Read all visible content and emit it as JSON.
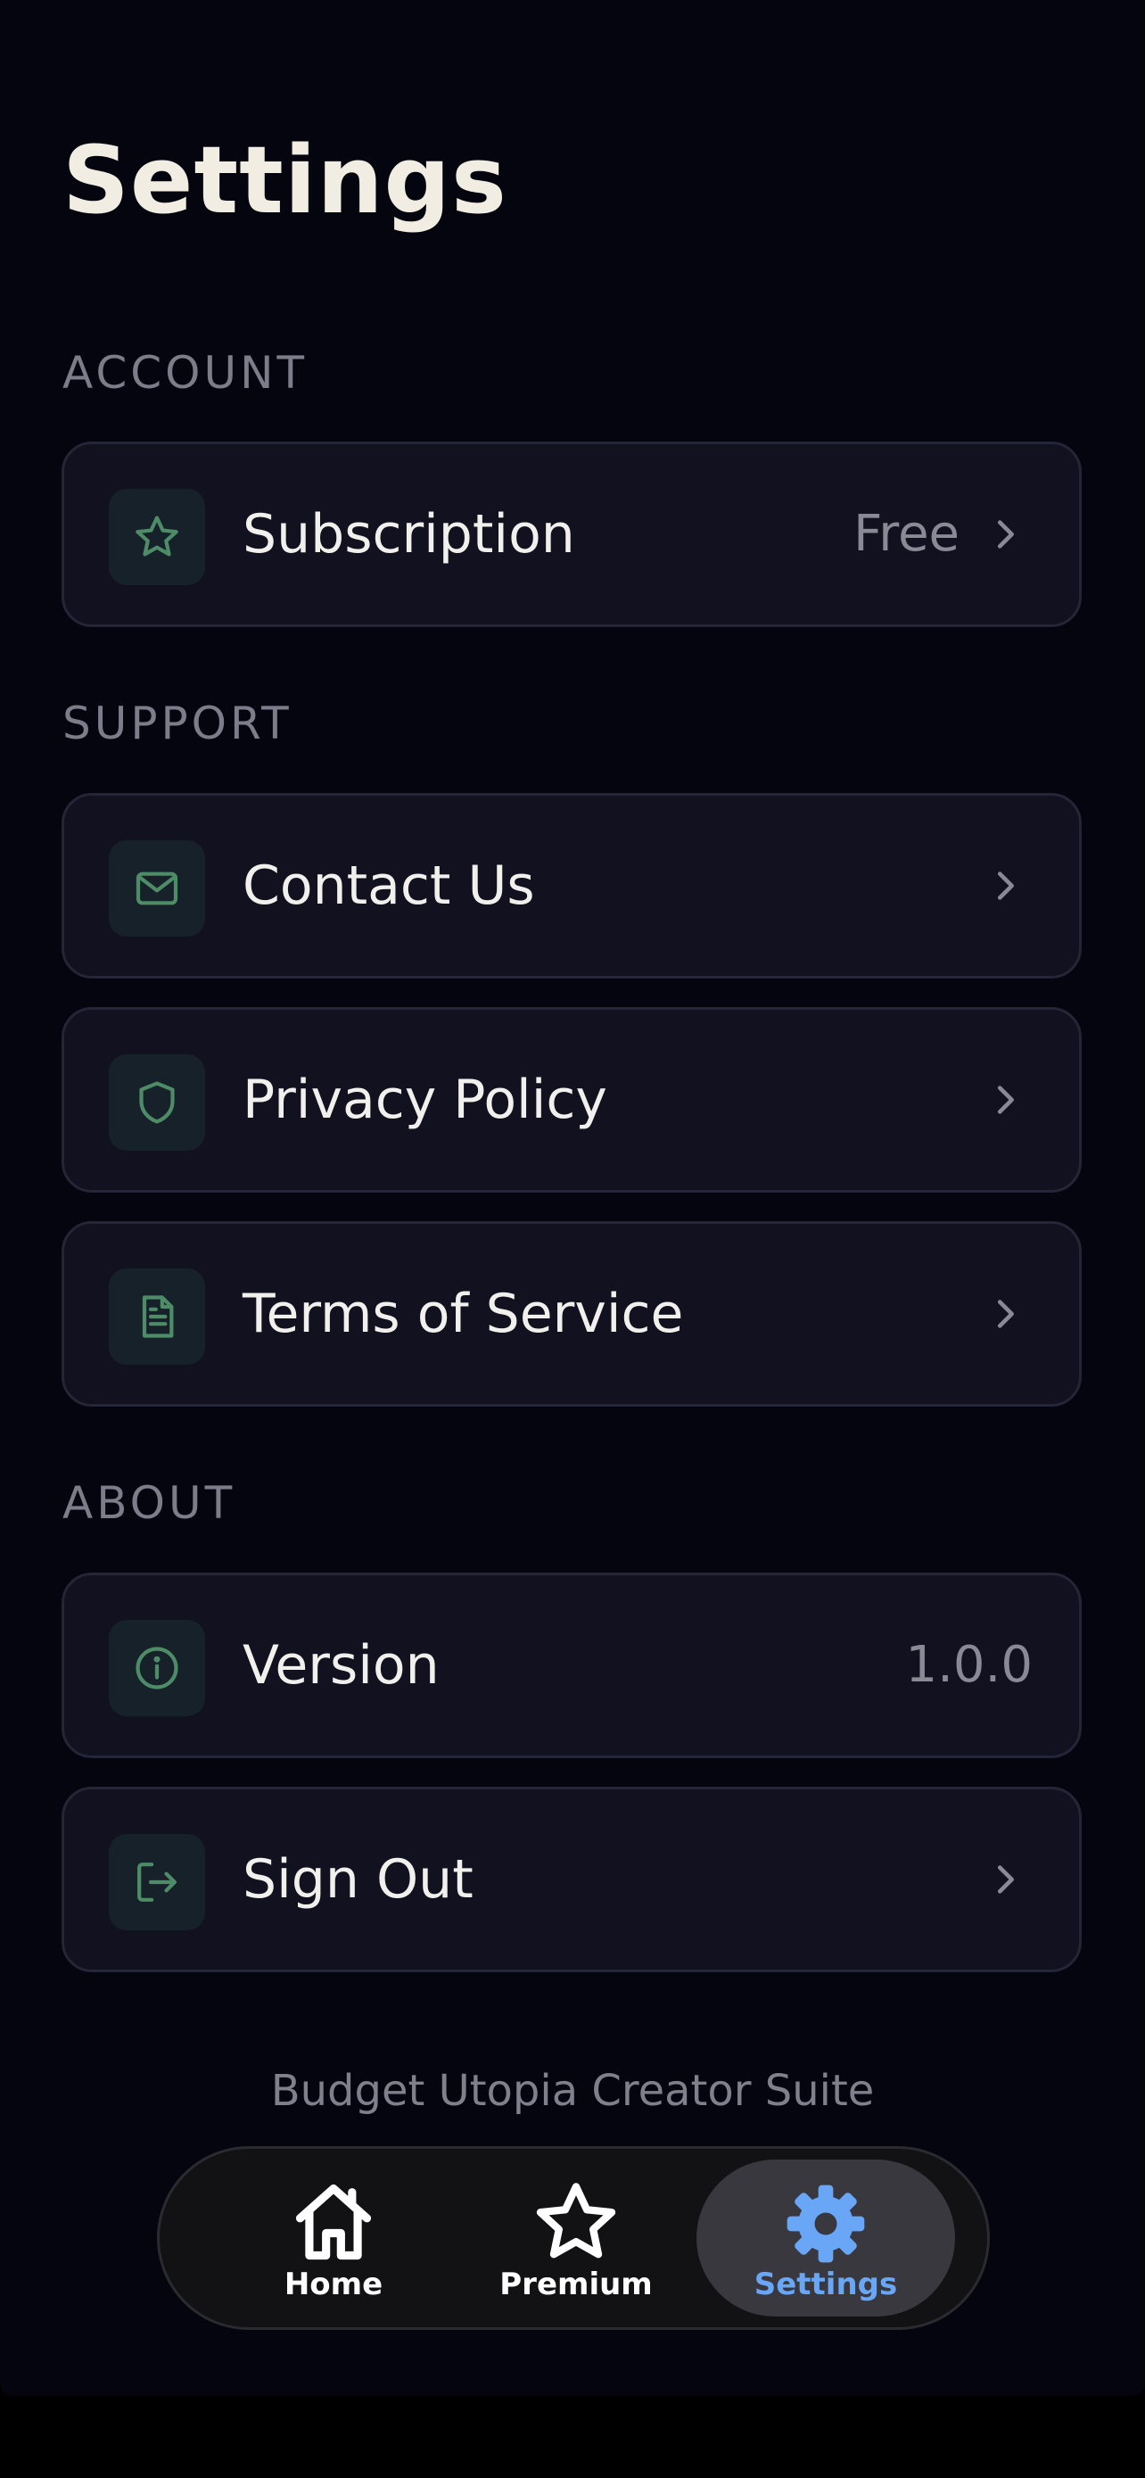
{
  "page": {
    "title": "Settings",
    "footer": "Budget Utopia Creator Suite"
  },
  "sections": {
    "account": {
      "label": "ACCOUNT",
      "items": [
        {
          "label": "Subscription",
          "value": "Free",
          "icon": "star-icon"
        }
      ]
    },
    "support": {
      "label": "SUPPORT",
      "items": [
        {
          "label": "Contact Us",
          "icon": "mail-icon"
        },
        {
          "label": "Privacy Policy",
          "icon": "shield-icon"
        },
        {
          "label": "Terms of Service",
          "icon": "document-icon"
        }
      ]
    },
    "about": {
      "label": "ABOUT",
      "items": [
        {
          "label": "Version",
          "value": "1.0.0",
          "icon": "info-icon"
        },
        {
          "label": "Sign Out",
          "icon": "sign-out-icon"
        }
      ]
    }
  },
  "tabbar": {
    "tabs": [
      {
        "label": "Home",
        "icon": "home-icon"
      },
      {
        "label": "Premium",
        "icon": "star-outline-icon"
      },
      {
        "label": "Settings",
        "icon": "gear-icon",
        "active": true
      }
    ]
  },
  "colors": {
    "background": "#05050f",
    "row_background": "#11111f",
    "row_border": "#252538",
    "icon_tile": "#17212a",
    "icon_accent": "#4e8c67",
    "active_tab": "#69a7f6",
    "title_text": "#f1ede3",
    "muted_text": "#7c7c8a"
  }
}
